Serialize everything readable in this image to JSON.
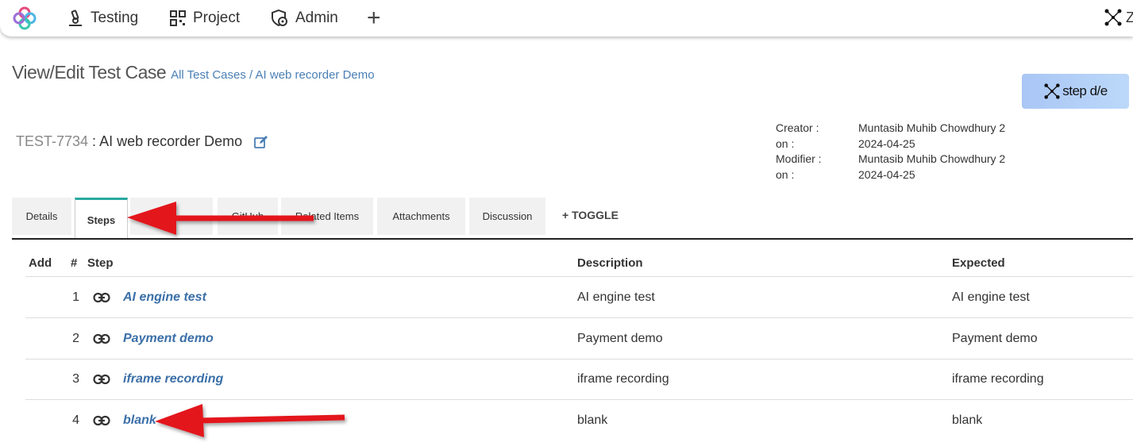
{
  "nav": {
    "items": [
      {
        "label": "Testing",
        "icon": "microscope-icon"
      },
      {
        "label": "Project",
        "icon": "qr-grid-icon"
      },
      {
        "label": "Admin",
        "icon": "shield-gear-icon"
      }
    ],
    "plus_label": "+",
    "user_initial": "Z"
  },
  "header": {
    "title": "View/Edit Test Case",
    "breadcrumb": "All Test Cases / AI web recorder Demo"
  },
  "stepde_button": "step d/e",
  "testcase": {
    "id": "TEST-7734",
    "separator": " : ",
    "name": "AI web recorder Demo"
  },
  "meta": [
    {
      "label": "Creator :",
      "value": "Muntasib Muhib Chowdhury 2"
    },
    {
      "label": "on :",
      "value": "2024-04-25"
    },
    {
      "label": "Modifier :",
      "value": "Muntasib Muhib Chowdhury 2"
    },
    {
      "label": "on :",
      "value": "2024-04-25"
    }
  ],
  "tabs": [
    "Details",
    "Steps",
    "",
    "GitHub",
    "Related Items",
    "Attachments",
    "Discussion"
  ],
  "active_tab": "Steps",
  "toggle_label": "+ TOGGLE",
  "table": {
    "headers": {
      "add": "Add",
      "num": "#",
      "step": "Step",
      "description": "Description",
      "expected": "Expected"
    },
    "rows": [
      {
        "num": "1",
        "step": "AI engine test",
        "description": "AI engine test",
        "expected": "AI engine test"
      },
      {
        "num": "2",
        "step": "Payment demo",
        "description": "Payment demo",
        "expected": "Payment demo"
      },
      {
        "num": "3",
        "step": "iframe recording",
        "description": "iframe recording",
        "expected": "iframe recording"
      },
      {
        "num": "4",
        "step": "blank",
        "description": "blank",
        "expected": "blank"
      }
    ]
  },
  "colors": {
    "accent": "#28a9a0",
    "link": "#3b6fa8",
    "arrow": "#e3161b"
  }
}
